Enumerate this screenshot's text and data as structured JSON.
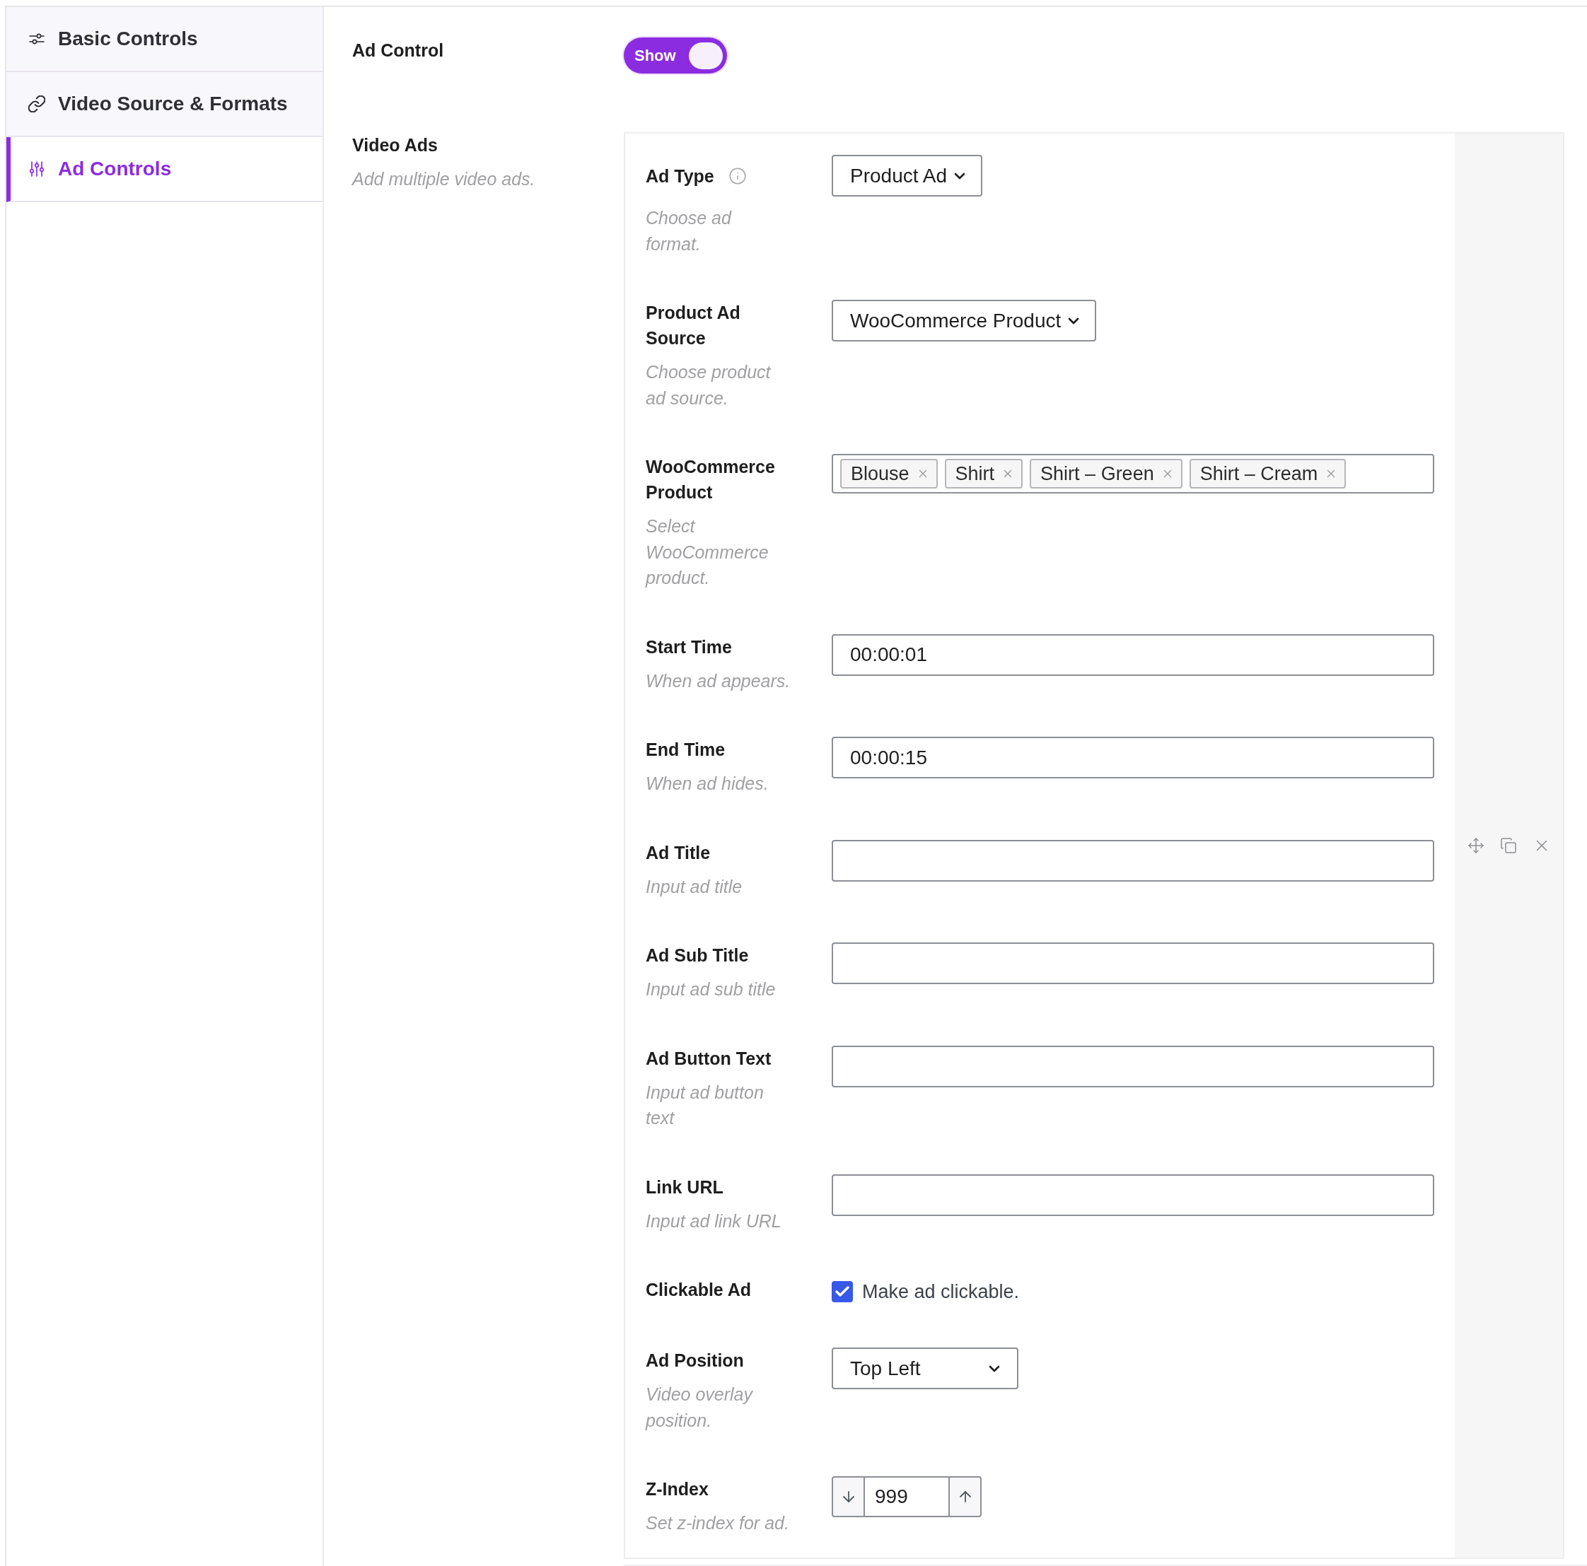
{
  "sidebar": {
    "items": [
      {
        "label": "Basic Controls",
        "selected": false
      },
      {
        "label": "Video Source & Formats",
        "selected": false
      },
      {
        "label": "Ad Controls",
        "selected": true
      }
    ]
  },
  "ad_control": {
    "label": "Ad Control",
    "toggle": {
      "text": "Show",
      "on": true
    }
  },
  "video_ads": {
    "label": "Video Ads",
    "description": "Add multiple video ads.",
    "ads": [
      {
        "fields": [
          {
            "kind": "select",
            "label": "Ad Type",
            "has_info": true,
            "description": "Choose ad format.",
            "value": "Product Ad"
          },
          {
            "kind": "select",
            "label": "Product Ad Source",
            "has_info": false,
            "description": "Choose product ad source.",
            "value": "WooCommerce Product"
          },
          {
            "kind": "tags",
            "label": "WooCommerce Product",
            "has_info": false,
            "description": "Select WooCommerce product.",
            "tags": [
              {
                "label": "Blouse"
              },
              {
                "label": "Shirt"
              },
              {
                "label": "Shirt – Green"
              },
              {
                "label": "Shirt – Cream"
              }
            ]
          },
          {
            "kind": "text",
            "label": "Start Time",
            "has_info": false,
            "description": "When ad appears.",
            "value": "00:00:01"
          },
          {
            "kind": "text",
            "label": "End Time",
            "has_info": false,
            "description": "When ad hides.",
            "value": "00:00:15"
          },
          {
            "kind": "text",
            "label": "Ad Title",
            "has_info": false,
            "description": "Input ad title"
          },
          {
            "kind": "text",
            "label": "Ad Sub Title",
            "has_info": false,
            "description": "Input ad sub title"
          },
          {
            "kind": "text",
            "label": "Ad Button Text",
            "has_info": false,
            "description": "Input ad button text"
          },
          {
            "kind": "text",
            "label": "Link URL",
            "has_info": false,
            "description": "Input ad link URL"
          },
          {
            "kind": "checkbox",
            "label": "Clickable Ad",
            "has_info": false,
            "checked": true,
            "text": "Make ad clickable."
          },
          {
            "kind": "dropdown",
            "label": "Ad Position",
            "has_info": false,
            "description": "Video overlay position.",
            "value": "Top Left"
          },
          {
            "kind": "number",
            "label": "Z-Index",
            "has_info": false,
            "description": "Set z-index for ad.",
            "value": "999"
          }
        ]
      }
    ]
  }
}
